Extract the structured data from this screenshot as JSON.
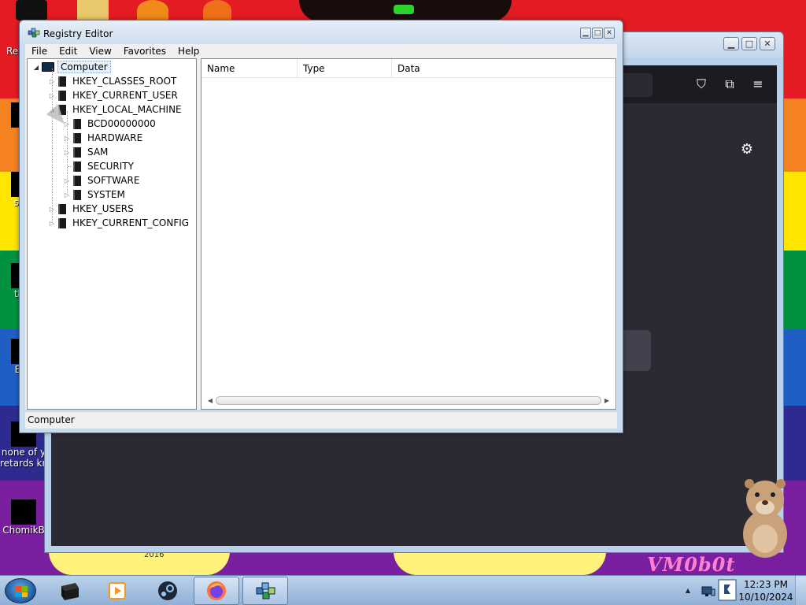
{
  "desktop": {
    "icons": [
      {
        "label": "Rec"
      },
      {
        "label": "F"
      },
      {
        "label": "som\nre"
      },
      {
        "label": "that"
      },
      {
        "label": "End"
      },
      {
        "label": "none of y\nretards kn"
      },
      {
        "label": "ChomikB"
      }
    ],
    "wallpaper_text": "VM0b0t",
    "wallpaper_year": "2016"
  },
  "regedit": {
    "title": "Registry Editor",
    "menu": [
      "File",
      "Edit",
      "View",
      "Favorites",
      "Help"
    ],
    "tree": {
      "root": "Computer",
      "hives": [
        {
          "label": "HKEY_CLASSES_ROOT"
        },
        {
          "label": "HKEY_CURRENT_USER"
        },
        {
          "label": "HKEY_LOCAL_MACHINE"
        },
        {
          "label": "HKEY_USERS"
        },
        {
          "label": "HKEY_CURRENT_CONFIG"
        }
      ],
      "hklm_children": [
        "BCD00000000",
        "HARDWARE",
        "SAM",
        "SECURITY",
        "SOFTWARE",
        "SYSTEM"
      ]
    },
    "columns": [
      "Name",
      "Type",
      "Data"
    ],
    "status": "Computer"
  },
  "taskbar": {
    "clock_time": "12:23 PM",
    "clock_date": "10/10/2024"
  },
  "colors": {
    "taskbar": "#a9c4e3",
    "window_frame": "#c9dcee",
    "browser_dark": "#2b2a33"
  }
}
